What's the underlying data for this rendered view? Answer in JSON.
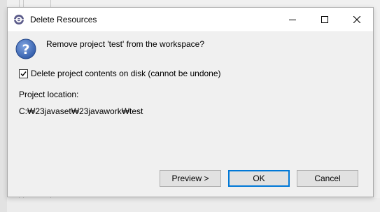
{
  "window": {
    "title": "Delete Resources",
    "icon": "eclipse-app-icon",
    "controls": [
      "minimize-icon",
      "maximize-icon",
      "close-icon"
    ]
  },
  "dialog": {
    "icon": "question-icon",
    "message": "Remove project 'test' from the workspace?",
    "delete_contents": {
      "checked": true,
      "label": "Delete project contents on disk (cannot be undone)"
    },
    "location_label": "Project location:",
    "location_value": "C:₩23javaset₩23javawork₩test"
  },
  "buttons": {
    "preview": "Preview >",
    "ok": "OK",
    "cancel": "Cancel"
  },
  "colors": {
    "focus_border": "#0078d7",
    "question_icon": "#2f5aa8"
  }
}
